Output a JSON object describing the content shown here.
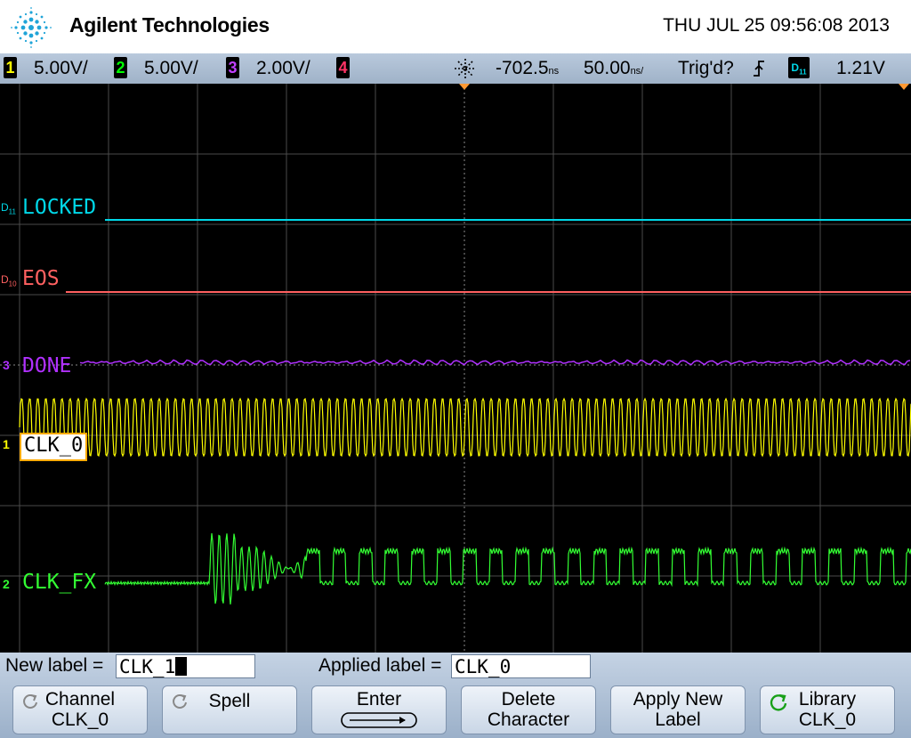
{
  "header": {
    "brand": "Agilent Technologies",
    "datetime": "THU JUL 25 09:56:08 2013"
  },
  "statusbar": {
    "ch1": {
      "num": "1",
      "scale": "5.00V/",
      "color": "#ffff00"
    },
    "ch2": {
      "num": "2",
      "scale": "5.00V/",
      "color": "#00ff00"
    },
    "ch3": {
      "num": "3",
      "scale": "2.00V/",
      "color": "#c040ff"
    },
    "ch4": {
      "num": "4",
      "color": "#ff3366"
    },
    "delay": "-702.5",
    "delay_unit": "ns",
    "timebase": "50.00",
    "timebase_unit": "ns/",
    "trigger_status": "Trig'd?",
    "trigger_source": "D11",
    "trigger_level": "1.21V"
  },
  "traces": {
    "locked": {
      "marker": "D11",
      "label": "LOCKED",
      "color": "#00d8e8"
    },
    "eos": {
      "marker": "D10",
      "label": "EOS",
      "color": "#ff6060"
    },
    "done": {
      "marker": "3",
      "label": "DONE",
      "color": "#b030ff"
    },
    "clk0": {
      "marker": "1",
      "label": "CLK_0",
      "color": "#ffff00"
    },
    "clkfx": {
      "marker": "2",
      "label": "CLK_FX",
      "color": "#33ff33"
    }
  },
  "bottom": {
    "new_label_caption": "New label =",
    "new_label_value": "CLK_1",
    "applied_label_caption": "Applied label =",
    "applied_label_value": "CLK_0",
    "softkeys": {
      "channel": {
        "line1": "Channel",
        "line2": "CLK_0"
      },
      "spell": {
        "line1": "Spell"
      },
      "enter": {
        "line1": "Enter"
      },
      "delete": {
        "line1": "Delete",
        "line2": "Character"
      },
      "apply": {
        "line1": "Apply New",
        "line2": "Label"
      },
      "library": {
        "line1": "Library",
        "line2": "CLK_0"
      }
    }
  }
}
